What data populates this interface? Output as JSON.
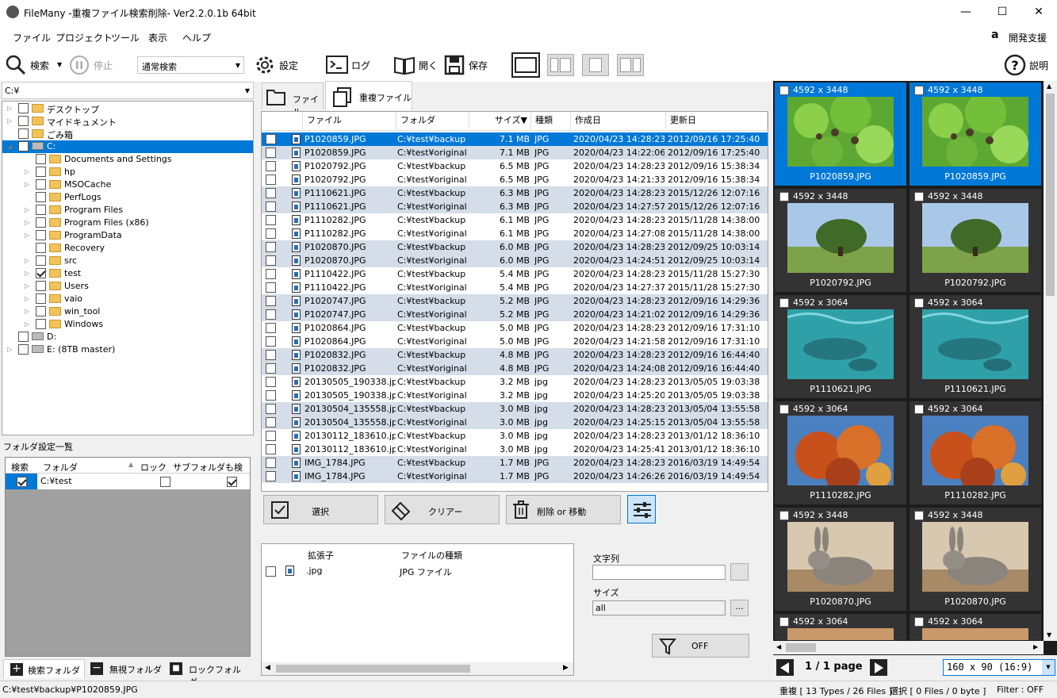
{
  "window": {
    "title": "FileMany -重複ファイル検索削除- Ver2.2.0.1b 64bit",
    "controls": [
      "—",
      "☐",
      "✕"
    ]
  },
  "menu": [
    "ファイル",
    "プロジェクト",
    "ツール",
    "表示",
    "ヘルプ"
  ],
  "support_label": "開発支援",
  "toolbar": {
    "search": "検索",
    "stop": "停止",
    "mode": "通常検索",
    "settings": "設定",
    "log": "ログ",
    "open": "開く",
    "save": "保存",
    "help": "説明"
  },
  "drive_combo": "C:¥",
  "tree": [
    {
      "label": "デスクトップ",
      "indent": 0,
      "type": "desktop",
      "exp": true
    },
    {
      "label": "マイドキュメント",
      "indent": 0,
      "type": "docs",
      "exp": true
    },
    {
      "label": "ごみ箱",
      "indent": 0,
      "type": "trash",
      "exp": false
    },
    {
      "label": "C:",
      "indent": 0,
      "type": "drive",
      "exp": true,
      "open": true,
      "selected": true
    },
    {
      "label": "Documents and Settings",
      "indent": 1,
      "type": "folder",
      "exp": false
    },
    {
      "label": "hp",
      "indent": 1,
      "type": "folder",
      "exp": true
    },
    {
      "label": "MSOCache",
      "indent": 1,
      "type": "folder",
      "exp": true
    },
    {
      "label": "PerfLogs",
      "indent": 1,
      "type": "folder",
      "exp": false
    },
    {
      "label": "Program Files",
      "indent": 1,
      "type": "folder",
      "exp": true
    },
    {
      "label": "Program Files (x86)",
      "indent": 1,
      "type": "folder",
      "exp": true
    },
    {
      "label": "ProgramData",
      "indent": 1,
      "type": "folder",
      "exp": true
    },
    {
      "label": "Recovery",
      "indent": 1,
      "type": "folder",
      "exp": false
    },
    {
      "label": "src",
      "indent": 1,
      "type": "folder",
      "exp": true
    },
    {
      "label": "test",
      "indent": 1,
      "type": "folder",
      "exp": true,
      "checked": true
    },
    {
      "label": "Users",
      "indent": 1,
      "type": "folder",
      "exp": true
    },
    {
      "label": "vaio",
      "indent": 1,
      "type": "folder",
      "exp": true
    },
    {
      "label": "win_tool",
      "indent": 1,
      "type": "folder",
      "exp": true
    },
    {
      "label": "Windows",
      "indent": 1,
      "type": "folder",
      "exp": true
    },
    {
      "label": "D:",
      "indent": 0,
      "type": "cd",
      "exp": false
    },
    {
      "label": "E: (8TB master)",
      "indent": 0,
      "type": "drive",
      "exp": true
    }
  ],
  "folder_settings": {
    "title": "フォルダ設定一覧",
    "columns": [
      "検索",
      "フォルダ",
      "ロック",
      "サブフォルダも検索"
    ],
    "rows": [
      {
        "search": true,
        "folder": "C:¥test",
        "lock": false,
        "sub": true
      }
    ]
  },
  "folder_tabs": [
    "検索フォルダ",
    "無視フォルダ",
    "ロックフォルダ"
  ],
  "tabs": [
    "ファイル",
    "重複ファイル"
  ],
  "file_columns": [
    "ファイル",
    "フォルダ",
    "サイズ▼",
    "種類",
    "作成日",
    "更新日"
  ],
  "files": [
    [
      "P1020859.JPG",
      "C:¥test¥backup",
      "7.1 MB",
      "JPG",
      "2020/04/23 14:28:23",
      "2012/09/16 17:25:40"
    ],
    [
      "P1020859.JPG",
      "C:¥test¥original",
      "7.1 MB",
      "JPG",
      "2020/04/23 14:22:06",
      "2012/09/16 17:25:40"
    ],
    [
      "P1020792.JPG",
      "C:¥test¥backup",
      "6.5 MB",
      "JPG",
      "2020/04/23 14:28:23",
      "2012/09/16 15:38:34"
    ],
    [
      "P1020792.JPG",
      "C:¥test¥original",
      "6.5 MB",
      "JPG",
      "2020/04/23 14:21:33",
      "2012/09/16 15:38:34"
    ],
    [
      "P1110621.JPG",
      "C:¥test¥backup",
      "6.3 MB",
      "JPG",
      "2020/04/23 14:28:23",
      "2015/12/26 12:07:16"
    ],
    [
      "P1110621.JPG",
      "C:¥test¥original",
      "6.3 MB",
      "JPG",
      "2020/04/23 14:27:57",
      "2015/12/26 12:07:16"
    ],
    [
      "P1110282.JPG",
      "C:¥test¥backup",
      "6.1 MB",
      "JPG",
      "2020/04/23 14:28:23",
      "2015/11/28 14:38:00"
    ],
    [
      "P1110282.JPG",
      "C:¥test¥original",
      "6.1 MB",
      "JPG",
      "2020/04/23 14:27:08",
      "2015/11/28 14:38:00"
    ],
    [
      "P1020870.JPG",
      "C:¥test¥backup",
      "6.0 MB",
      "JPG",
      "2020/04/23 14:28:23",
      "2012/09/25 10:03:14"
    ],
    [
      "P1020870.JPG",
      "C:¥test¥original",
      "6.0 MB",
      "JPG",
      "2020/04/23 14:24:51",
      "2012/09/25 10:03:14"
    ],
    [
      "P1110422.JPG",
      "C:¥test¥backup",
      "5.4 MB",
      "JPG",
      "2020/04/23 14:28:23",
      "2015/11/28 15:27:30"
    ],
    [
      "P1110422.JPG",
      "C:¥test¥original",
      "5.4 MB",
      "JPG",
      "2020/04/23 14:27:37",
      "2015/11/28 15:27:30"
    ],
    [
      "P1020747.JPG",
      "C:¥test¥backup",
      "5.2 MB",
      "JPG",
      "2020/04/23 14:28:23",
      "2012/09/16 14:29:36"
    ],
    [
      "P1020747.JPG",
      "C:¥test¥original",
      "5.2 MB",
      "JPG",
      "2020/04/23 14:21:02",
      "2012/09/16 14:29:36"
    ],
    [
      "P1020864.JPG",
      "C:¥test¥backup",
      "5.0 MB",
      "JPG",
      "2020/04/23 14:28:23",
      "2012/09/16 17:31:10"
    ],
    [
      "P1020864.JPG",
      "C:¥test¥original",
      "5.0 MB",
      "JPG",
      "2020/04/23 14:21:58",
      "2012/09/16 17:31:10"
    ],
    [
      "P1020832.JPG",
      "C:¥test¥backup",
      "4.8 MB",
      "JPG",
      "2020/04/23 14:28:23",
      "2012/09/16 16:44:40"
    ],
    [
      "P1020832.JPG",
      "C:¥test¥original",
      "4.8 MB",
      "JPG",
      "2020/04/23 14:24:08",
      "2012/09/16 16:44:40"
    ],
    [
      "20130505_190338.jpg",
      "C:¥test¥backup",
      "3.2 MB",
      "jpg",
      "2020/04/23 14:28:23",
      "2013/05/05 19:03:38"
    ],
    [
      "20130505_190338.jpg",
      "C:¥test¥original",
      "3.2 MB",
      "jpg",
      "2020/04/23 14:25:20",
      "2013/05/05 19:03:38"
    ],
    [
      "20130504_135558.jpg",
      "C:¥test¥backup",
      "3.0 MB",
      "jpg",
      "2020/04/23 14:28:23",
      "2013/05/04 13:55:58"
    ],
    [
      "20130504_135558.jpg",
      "C:¥test¥original",
      "3.0 MB",
      "jpg",
      "2020/04/23 14:25:15",
      "2013/05/04 13:55:58"
    ],
    [
      "20130112_183610.jpg",
      "C:¥test¥backup",
      "3.0 MB",
      "jpg",
      "2020/04/23 14:28:23",
      "2013/01/12 18:36:10"
    ],
    [
      "20130112_183610.jpg",
      "C:¥test¥original",
      "3.0 MB",
      "jpg",
      "2020/04/23 14:25:41",
      "2013/01/12 18:36:10"
    ],
    [
      "IMG_1784.JPG",
      "C:¥test¥backup",
      "1.7 MB",
      "JPG",
      "2020/04/23 14:28:23",
      "2016/03/19 14:49:54"
    ],
    [
      "IMG_1784.JPG",
      "C:¥test¥original",
      "1.7 MB",
      "JPG",
      "2020/04/23 14:26:26",
      "2016/03/19 14:49:54"
    ]
  ],
  "actions": {
    "select": "選択",
    "clear": "クリアー",
    "delete": "削除 or 移動"
  },
  "ext_table": {
    "columns": [
      "拡張子",
      "ファイルの種類"
    ],
    "rows": [
      [
        ".jpg",
        "JPG ファイル"
      ]
    ]
  },
  "filter": {
    "text_label": "文字列",
    "text_value": "",
    "size_label": "サイズ",
    "size_value": "all",
    "dots": "...",
    "off": "OFF"
  },
  "thumbs": [
    {
      "dim": "4592 x 3448",
      "name": "P1020859.JPG",
      "kind": "leaves",
      "sel": true
    },
    {
      "dim": "4592 x 3448",
      "name": "P1020859.JPG",
      "kind": "leaves",
      "sel": true
    },
    {
      "dim": "4592 x 3448",
      "name": "P1020792.JPG",
      "kind": "tree"
    },
    {
      "dim": "4592 x 3448",
      "name": "P1020792.JPG",
      "kind": "tree"
    },
    {
      "dim": "4592 x 3064",
      "name": "P1110621.JPG",
      "kind": "water"
    },
    {
      "dim": "4592 x 3064",
      "name": "P1110621.JPG",
      "kind": "water"
    },
    {
      "dim": "4592 x 3064",
      "name": "P1110282.JPG",
      "kind": "autumn"
    },
    {
      "dim": "4592 x 3064",
      "name": "P1110282.JPG",
      "kind": "autumn"
    },
    {
      "dim": "4592 x 3448",
      "name": "P1020870.JPG",
      "kind": "rabbit"
    },
    {
      "dim": "4592 x 3448",
      "name": "P1020870.JPG",
      "kind": "rabbit"
    },
    {
      "dim": "4592 x 3064",
      "name": "",
      "kind": "partial"
    },
    {
      "dim": "4592 x 3064",
      "name": "",
      "kind": "partial"
    }
  ],
  "pager": {
    "text": "1 / 1 page",
    "size": "160 x 90 (16:9)"
  },
  "status": {
    "path": "C:¥test¥backup¥P1020859.JPG",
    "dup": "重複 [ 13 Types / 26 Files ]",
    "sel": "選択 [ 0 Files / 0 byte ]",
    "filter": "Filter : OFF"
  }
}
